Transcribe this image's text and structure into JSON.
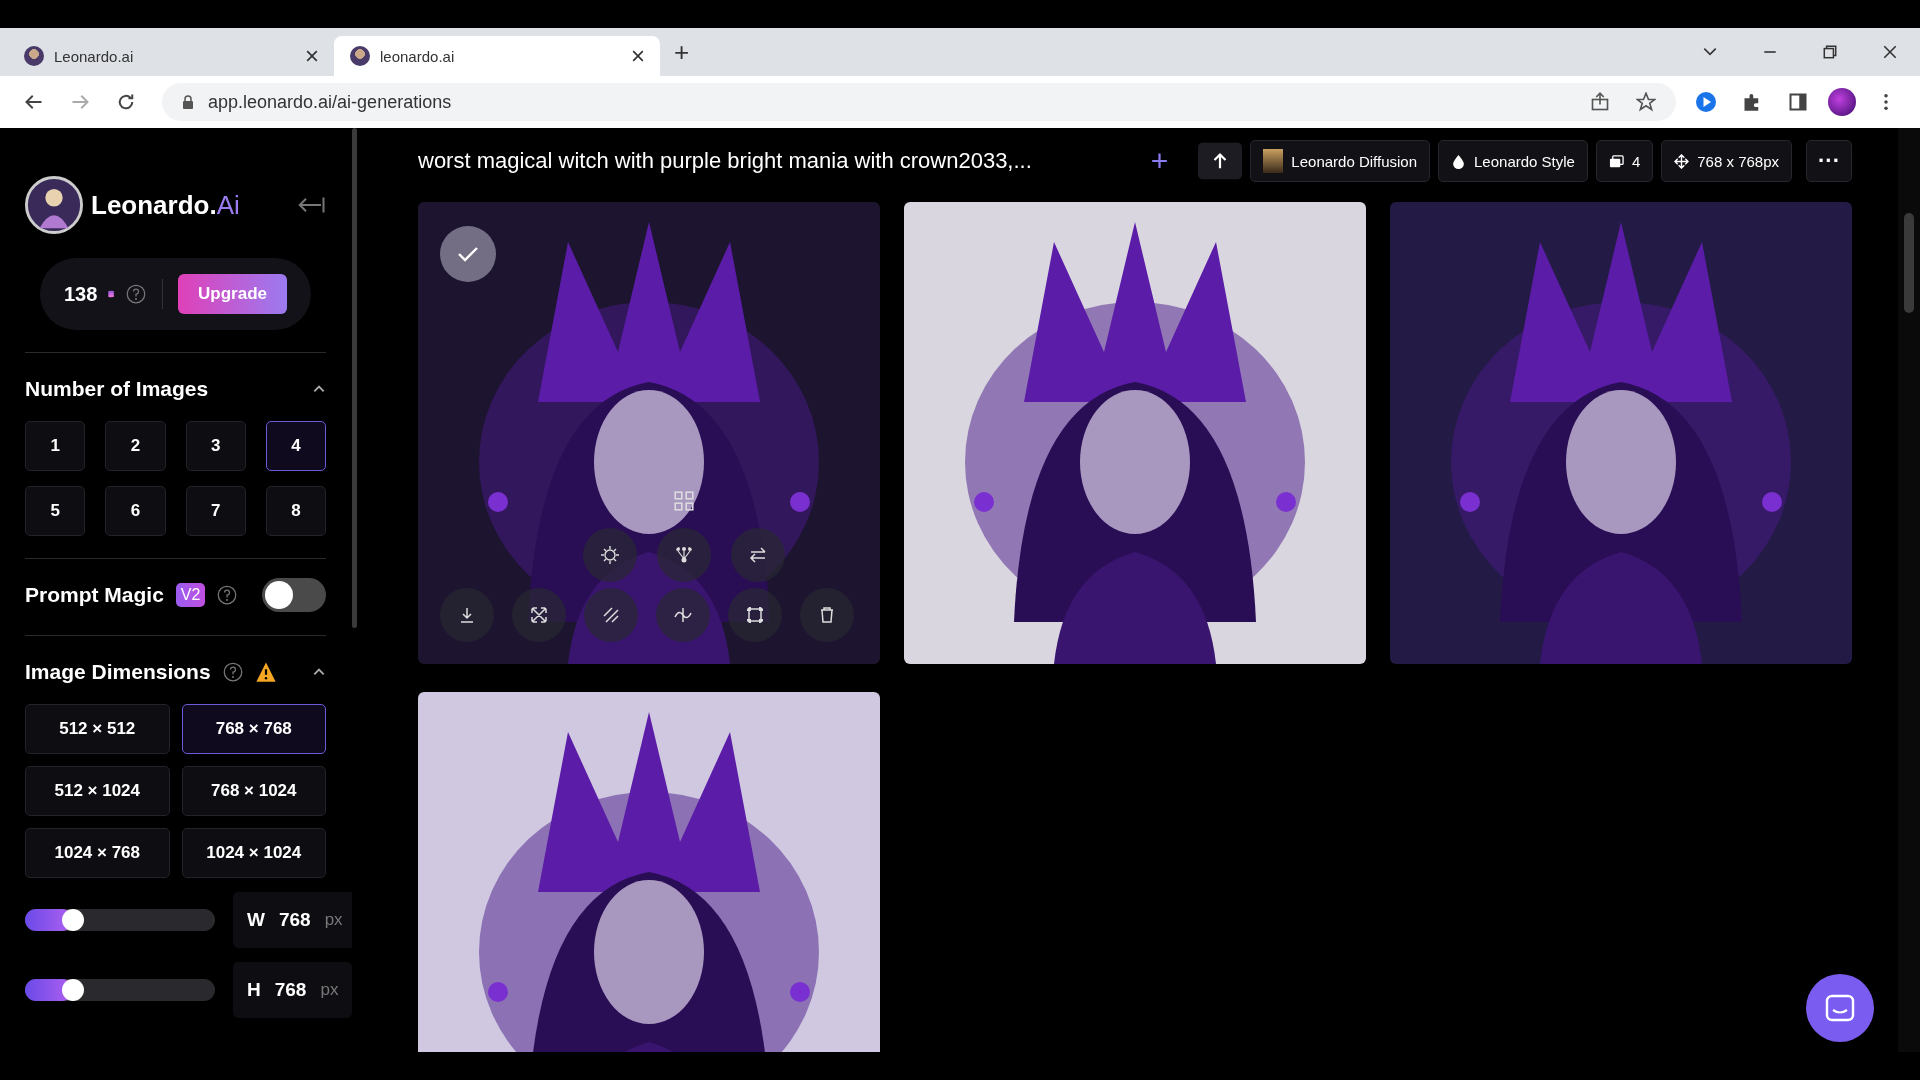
{
  "browser": {
    "tabs": [
      {
        "title": "Leonardo.ai",
        "selected": false
      },
      {
        "title": "leonardo.ai",
        "selected": true
      }
    ],
    "new_tab": "+",
    "url": "app.leonardo.ai/ai-generations"
  },
  "sidebar": {
    "brand": "Leonardo.",
    "brand_suffix": "Ai",
    "credits": "138",
    "upgrade": "Upgrade",
    "number_of_images": {
      "title": "Number of Images",
      "expanded": true,
      "options": [
        {
          "label": "1",
          "selected": false
        },
        {
          "label": "2",
          "selected": false
        },
        {
          "label": "3",
          "selected": false
        },
        {
          "label": "4",
          "selected": true
        },
        {
          "label": "5",
          "selected": false
        },
        {
          "label": "6",
          "selected": false
        },
        {
          "label": "7",
          "selected": false
        },
        {
          "label": "8",
          "selected": false
        }
      ]
    },
    "prompt_magic": {
      "title": "Prompt Magic",
      "badge": "V2",
      "on": false
    },
    "image_dimensions": {
      "title": "Image Dimensions",
      "warning": true,
      "expanded": true,
      "options": [
        {
          "label": "512 × 512",
          "selected": false
        },
        {
          "label": "768 × 768",
          "selected": true
        },
        {
          "label": "512 × 1024",
          "selected": false
        },
        {
          "label": "768 × 1024",
          "selected": false
        },
        {
          "label": "1024 × 768",
          "selected": false
        },
        {
          "label": "1024 × 1024",
          "selected": false
        }
      ]
    },
    "sliders": [
      {
        "axis": "W",
        "value": "768",
        "unit": "px",
        "level": 0.25
      },
      {
        "axis": "H",
        "value": "768",
        "unit": "px",
        "level": 0.25
      }
    ]
  },
  "generation": {
    "prompt": "worst magical witch with purple bright mania with crown2033,...",
    "add": "+",
    "chips": [
      {
        "kind": "model",
        "label": "Leonardo Diffusion"
      },
      {
        "kind": "style",
        "label": "Leonardo Style"
      },
      {
        "kind": "count",
        "label": "4"
      },
      {
        "kind": "size",
        "label": "768 x 768px"
      }
    ],
    "more": "···",
    "images": [
      {
        "kind": "picture",
        "selected": true,
        "hover": true
      },
      {
        "kind": "picture",
        "selected": false,
        "hover": false
      },
      {
        "kind": "picture",
        "selected": false,
        "hover": false
      },
      {
        "kind": "picture",
        "selected": false,
        "hover": false
      }
    ]
  }
}
